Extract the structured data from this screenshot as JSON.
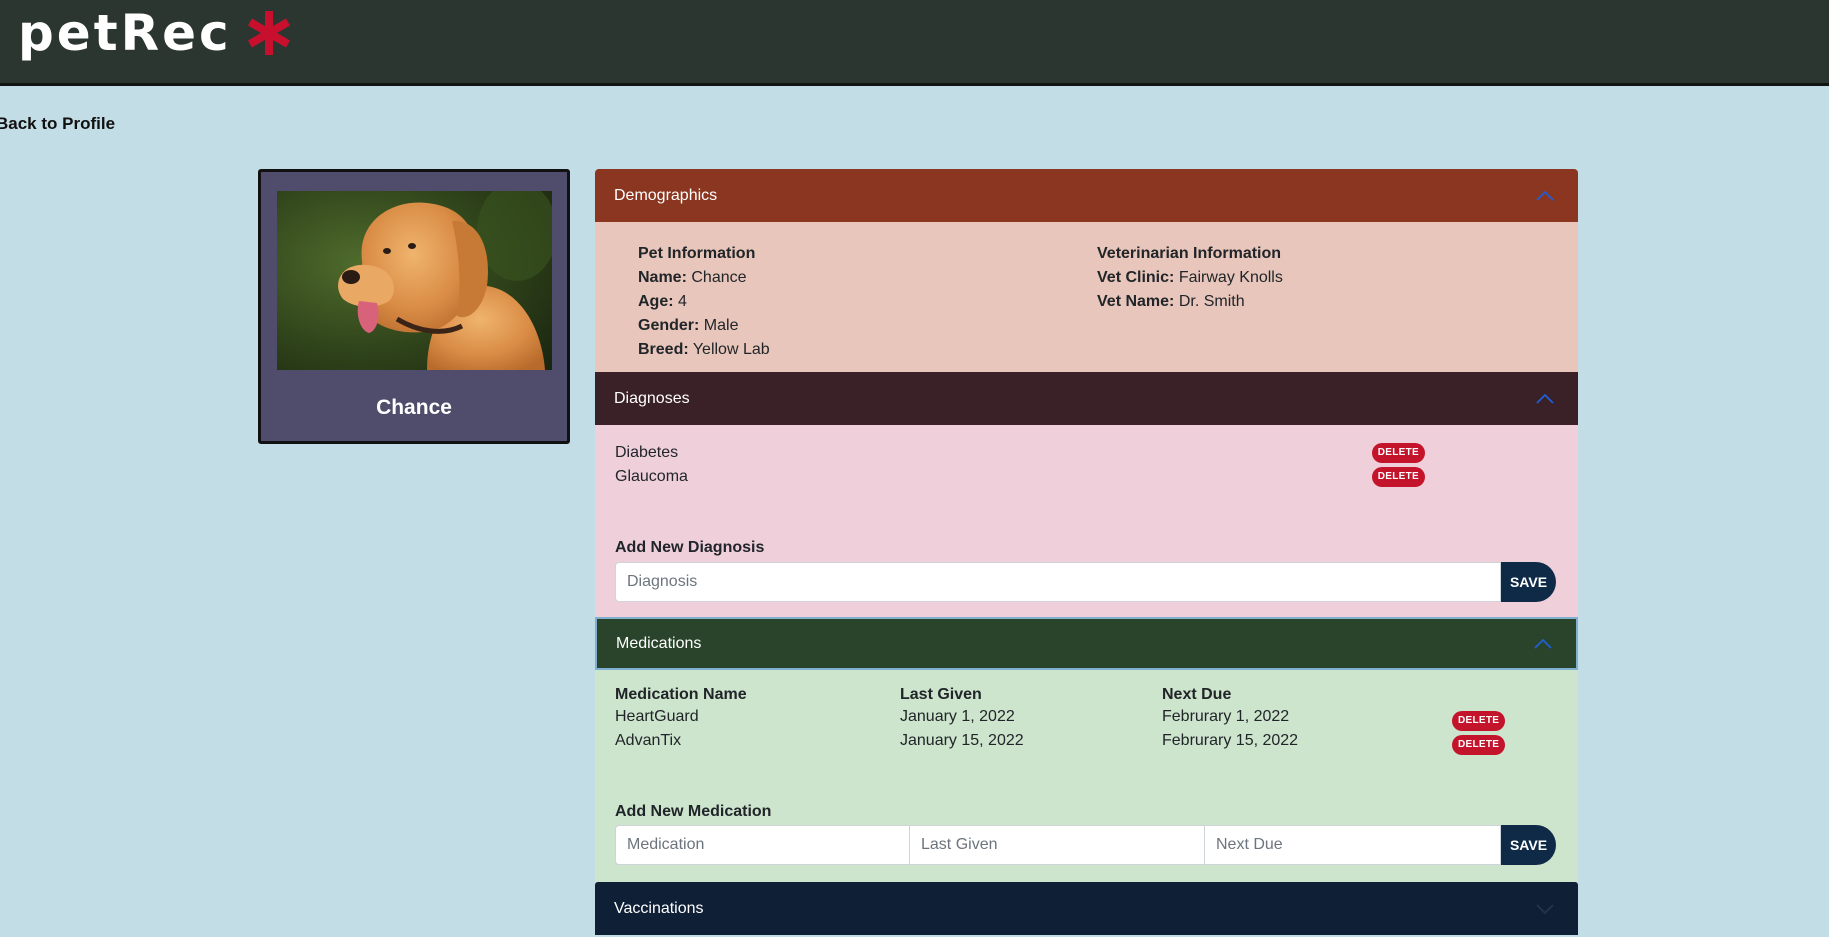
{
  "app": {
    "title": "petRec",
    "accent_color": "#c8102e"
  },
  "nav": {
    "back_label": "Back to Profile"
  },
  "pet_card": {
    "name": "Chance",
    "photo": "yellow-labrador-photo"
  },
  "demographics": {
    "header": "Demographics",
    "pet_info": {
      "heading": "Pet Information",
      "fields": [
        {
          "label": "Name:",
          "value": "Chance"
        },
        {
          "label": "Age:",
          "value": "4"
        },
        {
          "label": "Gender:",
          "value": "Male"
        },
        {
          "label": "Breed:",
          "value": "Yellow Lab"
        }
      ]
    },
    "vet_info": {
      "heading": "Veterinarian Information",
      "fields": [
        {
          "label": "Vet Clinic:",
          "value": "Fairway Knolls"
        },
        {
          "label": "Vet Name:",
          "value": "Dr. Smith"
        }
      ]
    }
  },
  "diagnoses": {
    "header": "Diagnoses",
    "items": [
      {
        "name": "Diabetes",
        "delete_label": "DELETE"
      },
      {
        "name": "Glaucoma",
        "delete_label": "DELETE"
      }
    ],
    "add_label": "Add New Diagnosis",
    "input_placeholder": "Diagnosis",
    "save_label": "SAVE"
  },
  "medications": {
    "header": "Medications",
    "columns": [
      "Medication Name",
      "Last Given",
      "Next Due"
    ],
    "rows": [
      {
        "name": "HeartGuard",
        "last_given": "January 1, 2022",
        "next_due": "Februrary 1, 2022",
        "delete_label": "DELETE"
      },
      {
        "name": "AdvanTix",
        "last_given": "January 15, 2022",
        "next_due": "Februrary 15, 2022",
        "delete_label": "DELETE"
      }
    ],
    "add_label": "Add New Medication",
    "placeholders": {
      "medication": "Medication",
      "last_given": "Last Given",
      "next_due": "Next Due"
    },
    "save_label": "SAVE"
  },
  "vaccinations": {
    "header": "Vaccinations"
  }
}
